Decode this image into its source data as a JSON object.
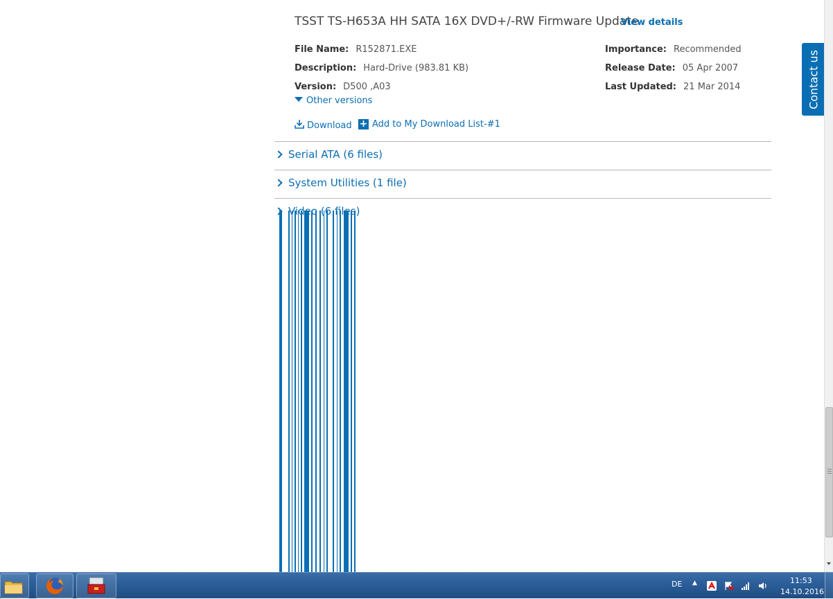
{
  "update": {
    "title": "TSST TS-H653A HH SATA 16X DVD+/-RW Firmware Update",
    "view_details": "View details",
    "file_name_label": "File Name:",
    "file_name": "R152871.EXE",
    "description_label": "Description:",
    "description": "Hard-Drive (983.81 KB)",
    "version_label": "Version:",
    "version": "D500 ,A03",
    "importance_label": "Importance:",
    "importance": "Recommended",
    "release_date_label": "Release Date:",
    "release_date": "05 Apr 2007",
    "last_updated_label": "Last Updated:",
    "last_updated": "21 Mar 2014",
    "other_versions": "Other versions",
    "download": "Download",
    "add_to_list": "Add to My Download List-#1"
  },
  "categories": [
    {
      "label": "Serial ATA (6 files)"
    },
    {
      "label": "System Utilities (1 file)"
    },
    {
      "label": "Video (6 files)"
    }
  ],
  "contact_tab": {
    "label": "Contact us"
  },
  "taskbar": {
    "language": "DE",
    "time": "11:53",
    "date": "14.10.2016"
  },
  "colors": {
    "link_blue": "#0a6eb4",
    "text_dark": "#444444",
    "taskbar": "#2c5f9b"
  }
}
